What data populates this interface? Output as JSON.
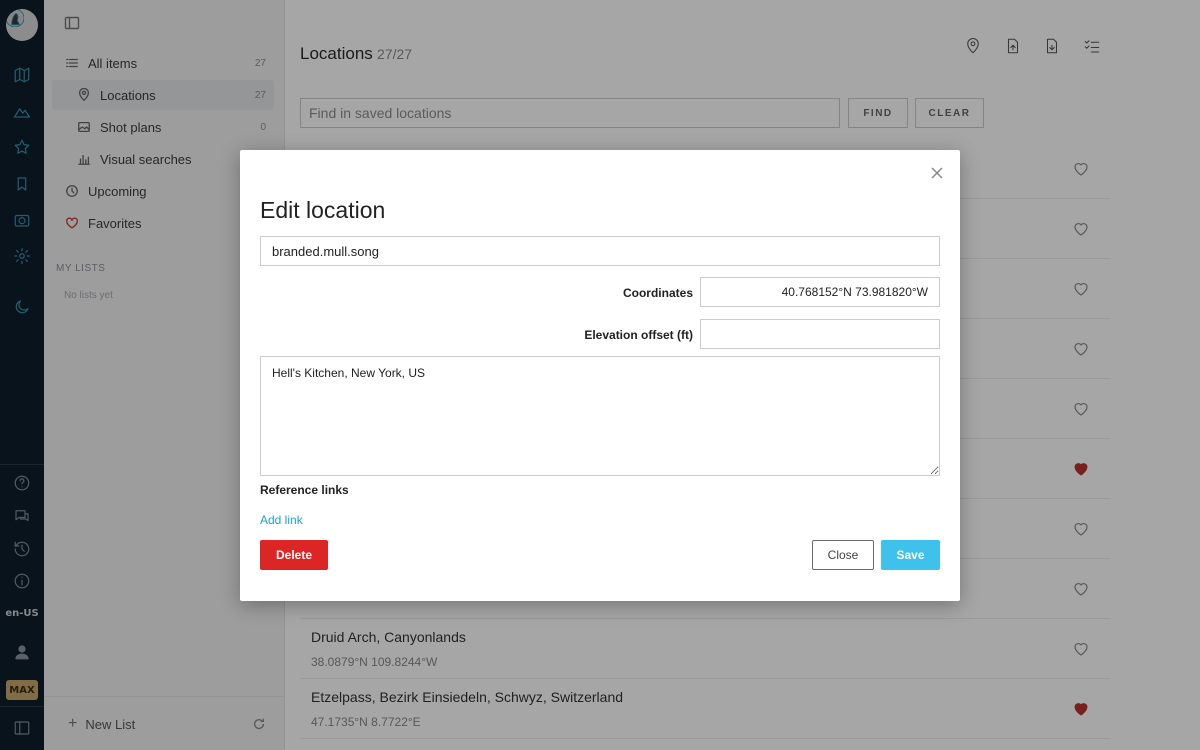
{
  "rail": {
    "language": "en-US",
    "plan_badge": "MAX"
  },
  "sidebar": {
    "items": [
      {
        "label": "All items",
        "count": "27",
        "icon": "list-icon"
      },
      {
        "label": "Locations",
        "count": "27",
        "icon": "location-pin-icon"
      },
      {
        "label": "Shot plans",
        "count": "0",
        "icon": "image-icon"
      },
      {
        "label": "Visual searches",
        "count": "",
        "icon": "chart-icon"
      },
      {
        "label": "Upcoming",
        "count": "",
        "icon": "clock-icon"
      },
      {
        "label": "Favorites",
        "count": "",
        "icon": "heart-icon"
      }
    ],
    "my_lists_title": "MY LISTS",
    "no_lists_text": "No lists yet",
    "new_list_label": "New List"
  },
  "main": {
    "title": "Locations",
    "count": "27/27",
    "search_placeholder": "Find in saved locations",
    "find_label": "FIND",
    "clear_label": "CLEAR",
    "rows": [
      {
        "name": "",
        "coords": "",
        "favorite": false
      },
      {
        "name": "",
        "coords": "",
        "favorite": false
      },
      {
        "name": "",
        "coords": "",
        "favorite": false
      },
      {
        "name": "",
        "coords": "",
        "favorite": false
      },
      {
        "name": "",
        "coords": "",
        "favorite": false
      },
      {
        "name": "",
        "coords": "",
        "favorite": true
      },
      {
        "name": "",
        "coords": "",
        "favorite": false
      },
      {
        "name": "",
        "coords": "",
        "favorite": false
      },
      {
        "name": "Druid Arch, Canyonlands",
        "coords": "38.0879°N 109.8244°W",
        "favorite": false
      },
      {
        "name": "Etzelpass, Bezirk Einsiedeln, Schwyz, Switzerland",
        "coords": "47.1735°N 8.7722°E",
        "favorite": true
      }
    ]
  },
  "modal": {
    "title": "Edit location",
    "name_value": "branded.mull.song",
    "coordinates_label": "Coordinates",
    "coordinates_value": "40.768152°N 73.981820°W",
    "elevation_label": "Elevation offset (ft)",
    "elevation_value": "",
    "notes_value": "Hell's Kitchen, New York, US",
    "reference_links_label": "Reference links",
    "add_link_label": "Add link",
    "delete_label": "Delete",
    "close_label": "Close",
    "save_label": "Save"
  },
  "colors": {
    "rail_bg": "#0f1e2c",
    "accent": "#3ec1ea",
    "danger": "#dc2626",
    "link": "#1ea0d0",
    "favorite_heart": "#b8322a"
  }
}
